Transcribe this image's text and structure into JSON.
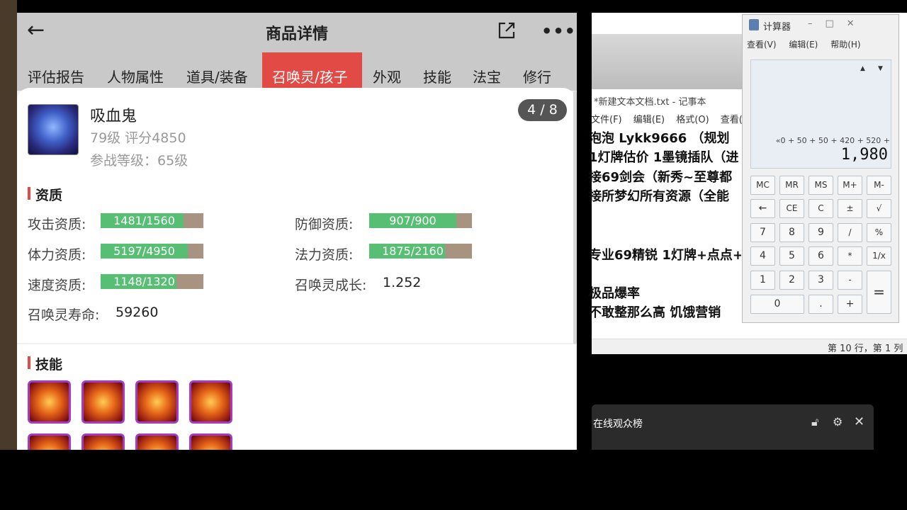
{
  "app": {
    "title": "商品详情",
    "tabs": [
      "评估报告",
      "人物属性",
      "道具/装备",
      "召唤灵/孩子",
      "外观",
      "技能",
      "法宝",
      "修行"
    ],
    "active_tab": 3
  },
  "pet": {
    "name": "吸血鬼",
    "level_score": "79级 评分4850",
    "battle_level": "参战等级：65级",
    "page": "4 / 8"
  },
  "aptitude": {
    "section_title": "资质",
    "attack_label": "攻击资质:",
    "attack_value": "1481/1560",
    "attack_frac": 0.949,
    "defense_label": "防御资质:",
    "defense_value": "907/900",
    "defense_frac": 1.0,
    "hp_label": "体力资质:",
    "hp_value": "5197/4950",
    "hp_frac": 1.0,
    "magic_label": "法力资质:",
    "magic_value": "1875/2160",
    "magic_frac": 0.868,
    "speed_label": "速度资质:",
    "speed_value": "1148/1320",
    "speed_frac": 0.87,
    "growth_label": "召唤灵成长:",
    "growth_value": "1.252",
    "life_label": "召唤灵寿命:",
    "life_value": "59260"
  },
  "skills": {
    "section_title": "技能",
    "count_visible": 8
  },
  "notepad": {
    "title": "*新建文本文档.txt - 记事本",
    "menu": [
      "文件(F)",
      "编辑(E)",
      "格式(O)",
      "查看(V)"
    ],
    "lines": [
      "泡泡 Lykk9666  （规划",
      "1灯牌估价 1墨镜插队（进",
      "接69剑会（新秀~至尊都",
      "接所梦幻所有资源（全能",
      "",
      "专业69精锐 1灯牌+点点+",
      "",
      "极品爆率",
      "不敢整那么高 饥饿营销"
    ],
    "status": "第 10 行，第 1 列"
  },
  "calculator": {
    "title": "计算器",
    "menu": [
      "查看(V)",
      "编辑(E)",
      "帮助(H)"
    ],
    "expression": "«0 + 50 + 50 + 420 + 520 +",
    "result": "1,980",
    "keys": [
      [
        "MC",
        "MR",
        "MS",
        "M+",
        "M-"
      ],
      [
        "←",
        "CE",
        "C",
        "±",
        "√"
      ],
      [
        "7",
        "8",
        "9",
        "/",
        "%"
      ],
      [
        "4",
        "5",
        "6",
        "*",
        "1/x"
      ],
      [
        "1",
        "2",
        "3",
        "-",
        "="
      ],
      [
        "0",
        ".",
        "+"
      ]
    ]
  },
  "viewer_panel": {
    "title": "在线观众榜"
  }
}
